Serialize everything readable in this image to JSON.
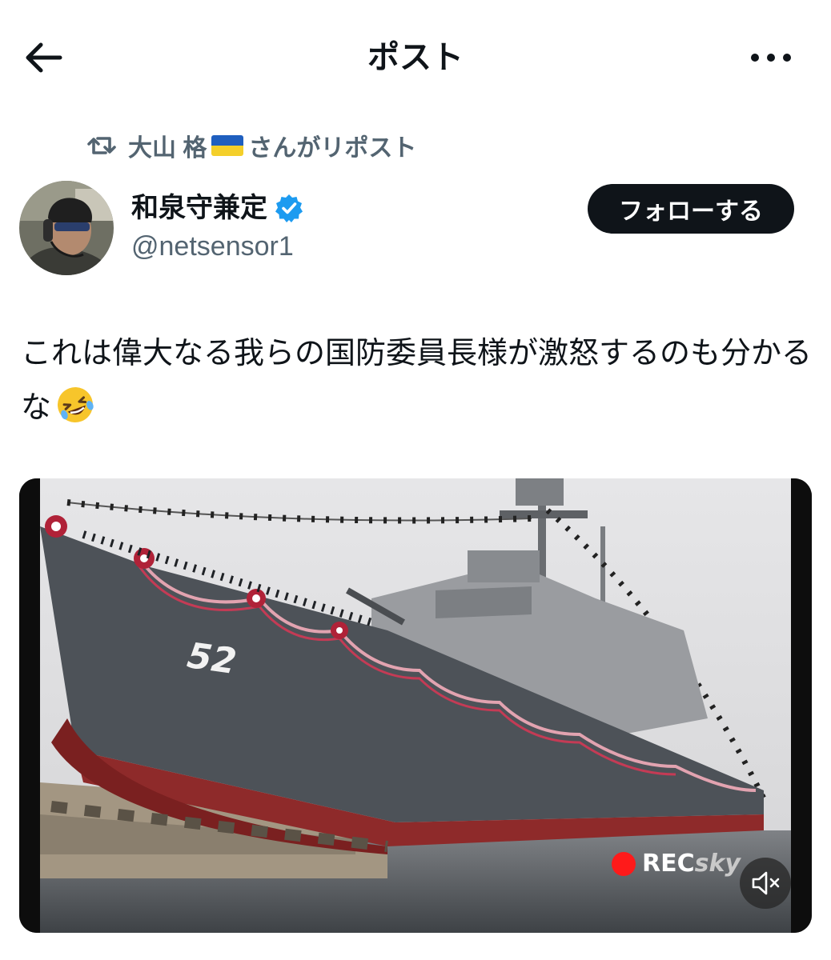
{
  "header": {
    "title": "ポスト",
    "back_icon": "arrow-left-icon",
    "more_icon": "ellipsis-icon"
  },
  "repost": {
    "user_name": "大山 格",
    "suffix": "さんがリポスト",
    "icon": "repost-icon"
  },
  "author": {
    "display_name": "和泉守兼定",
    "handle": "@netsensor1",
    "verified": true
  },
  "follow_button": {
    "label": "フォローする"
  },
  "post": {
    "text": "これは偉大なる我らの国防委員長様が激怒するのも分かるな"
  },
  "media": {
    "hull_number": "52",
    "watermark_rec": "REC",
    "watermark_sky": "sky",
    "mute_icon": "speaker-muted-icon"
  },
  "colors": {
    "text": "#0f1419",
    "secondary": "#536471",
    "verified": "#1d9bf0",
    "follow_bg": "#0f1419"
  }
}
